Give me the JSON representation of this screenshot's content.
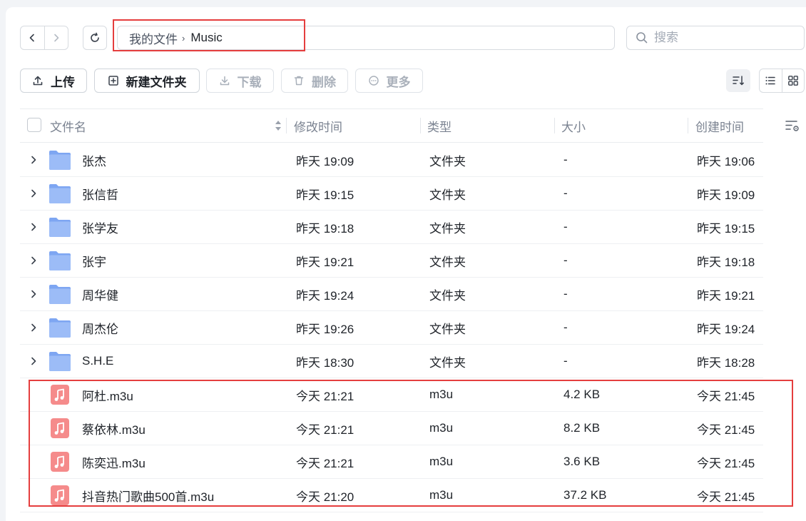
{
  "breadcrumb": {
    "root": "我的文件",
    "current": "Music"
  },
  "search": {
    "placeholder": "搜索"
  },
  "toolbar": {
    "upload": "上传",
    "new_folder": "新建文件夹",
    "download": "下载",
    "delete": "删除",
    "more": "更多"
  },
  "table": {
    "headers": {
      "name": "文件名",
      "modified": "修改时间",
      "type": "类型",
      "size": "大小",
      "created": "创建时间"
    },
    "rows": [
      {
        "kind": "folder",
        "name": "张杰",
        "modified": "昨天 19:09",
        "type": "文件夹",
        "size": "-",
        "created": "昨天 19:06"
      },
      {
        "kind": "folder",
        "name": "张信哲",
        "modified": "昨天 19:15",
        "type": "文件夹",
        "size": "-",
        "created": "昨天 19:09"
      },
      {
        "kind": "folder",
        "name": "张学友",
        "modified": "昨天 19:18",
        "type": "文件夹",
        "size": "-",
        "created": "昨天 19:15"
      },
      {
        "kind": "folder",
        "name": "张宇",
        "modified": "昨天 19:21",
        "type": "文件夹",
        "size": "-",
        "created": "昨天 19:18"
      },
      {
        "kind": "folder",
        "name": "周华健",
        "modified": "昨天 19:24",
        "type": "文件夹",
        "size": "-",
        "created": "昨天 19:21"
      },
      {
        "kind": "folder",
        "name": "周杰伦",
        "modified": "昨天 19:26",
        "type": "文件夹",
        "size": "-",
        "created": "昨天 19:24"
      },
      {
        "kind": "folder",
        "name": "S.H.E",
        "modified": "昨天 18:30",
        "type": "文件夹",
        "size": "-",
        "created": "昨天 18:28"
      },
      {
        "kind": "music",
        "name": "阿杜.m3u",
        "modified": "今天 21:21",
        "type": "m3u",
        "size": "4.2 KB",
        "created": "今天 21:45"
      },
      {
        "kind": "music",
        "name": "蔡依林.m3u",
        "modified": "今天 21:21",
        "type": "m3u",
        "size": "8.2 KB",
        "created": "今天 21:45"
      },
      {
        "kind": "music",
        "name": "陈奕迅.m3u",
        "modified": "今天 21:21",
        "type": "m3u",
        "size": "3.6 KB",
        "created": "今天 21:45"
      },
      {
        "kind": "music",
        "name": "抖音热门歌曲500首.m3u",
        "modified": "今天 21:20",
        "type": "m3u",
        "size": "37.2 KB",
        "created": "今天 21:45"
      }
    ]
  },
  "colors": {
    "accent_highlight": "#e53e3e",
    "folder": "#8fb4f5",
    "music": "#f58b8b"
  },
  "icons": [
    "chevron-left-icon",
    "chevron-right-icon",
    "refresh-icon",
    "search-icon",
    "upload-icon",
    "new-folder-icon",
    "download-icon",
    "delete-icon",
    "more-icon",
    "sort-icon",
    "list-view-icon",
    "grid-view-icon",
    "column-settings-icon",
    "folder-icon",
    "music-file-icon"
  ]
}
